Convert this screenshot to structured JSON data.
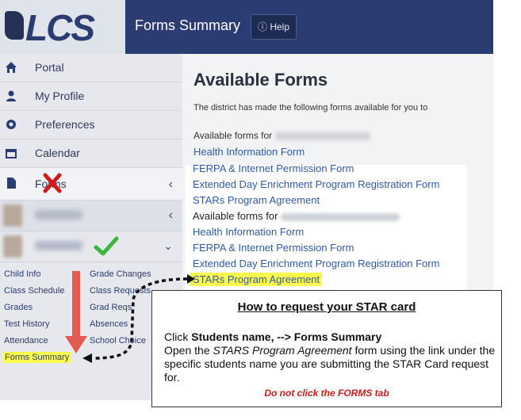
{
  "header": {
    "logo_text": "LCS",
    "title": "Forms Summary",
    "help_label": "Help"
  },
  "sidebar": {
    "items": [
      {
        "label": "Portal",
        "icon": "home-icon"
      },
      {
        "label": "My Profile",
        "icon": "user-icon"
      },
      {
        "label": "Preferences",
        "icon": "gear-icon"
      },
      {
        "label": "Calendar",
        "icon": "calendar-icon"
      },
      {
        "label": "Forms",
        "icon": "document-icon"
      }
    ],
    "subnav_left": [
      "Child Info",
      "Class Schedule",
      "Grades",
      "Test History",
      "Attendance",
      "Forms Summary"
    ],
    "subnav_right": [
      "Grade Changes",
      "Class Requests",
      "Grad Reqs",
      "Absences",
      "School Choice"
    ]
  },
  "main": {
    "title": "Available Forms",
    "intro": "The district has made the following forms available for you to",
    "avail_prefix": "Available forms for",
    "group1": [
      "Health Information Form",
      "FERPA & Internet Permission Form",
      "Extended Day Enrichment Program Registration Form",
      "STARs Program Agreement"
    ],
    "group2": [
      "Health Information Form",
      "FERPA & Internet Permission Form",
      "Extended Day Enrichment Program Registration Form",
      "STARs Program Agreement"
    ]
  },
  "callout": {
    "title": "How to request your STAR card",
    "line1_pre": "Click ",
    "line1_bold": "Students name, --> Forms Summary",
    "line2_pre": "Open the ",
    "line2_italic": "STARS Program Agreement",
    "line2_post": " form using the link under the specific students name you are submitting the STAR Card request for.",
    "warning": "Do not click the FORMS tab"
  },
  "colors": {
    "header": "#2a3c71",
    "highlight": "#fbfb4e",
    "link": "#2e5aa8",
    "warning": "#d11a1a",
    "check": "#3bb43b"
  }
}
